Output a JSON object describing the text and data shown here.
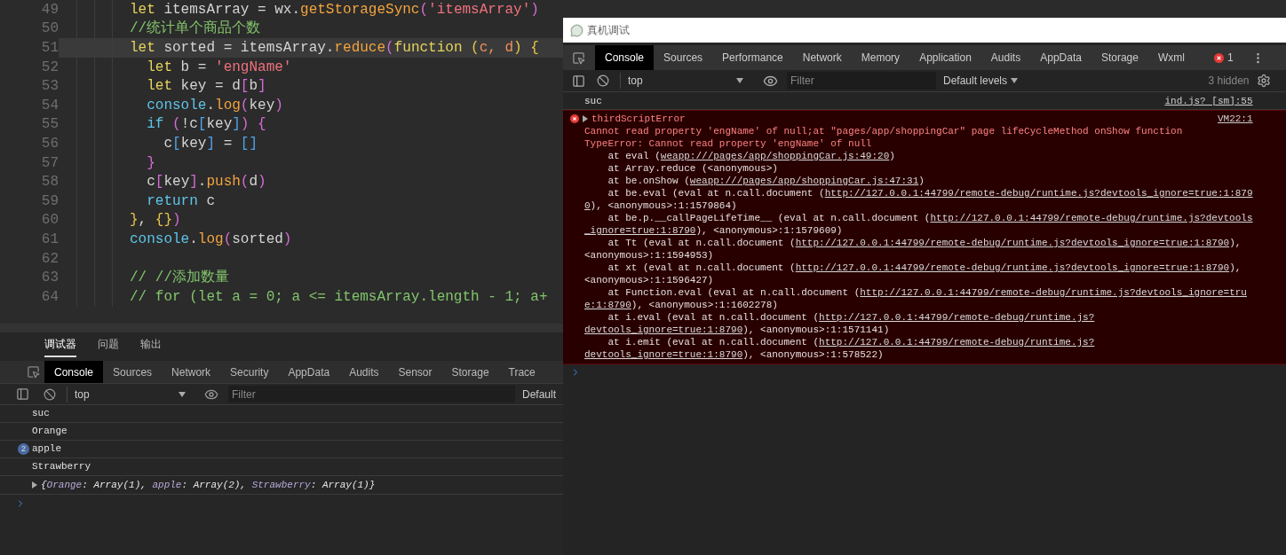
{
  "editor": {
    "lines": [
      {
        "number": "49",
        "current": false,
        "tokens": [
          {
            "kind": "kw",
            "text": "let"
          },
          {
            "kind": "id",
            "text": " itemsArray = wx."
          },
          {
            "kind": "fn",
            "text": "getStorageSync"
          },
          {
            "kind": "b2",
            "text": "("
          },
          {
            "kind": "str",
            "text": "'itemsArray'"
          },
          {
            "kind": "b2",
            "text": ")"
          }
        ]
      },
      {
        "number": "50",
        "current": false,
        "tokens": [
          {
            "kind": "cm",
            "text": "//统计单个商品个数"
          }
        ]
      },
      {
        "number": "51",
        "current": true,
        "tokens": [
          {
            "kind": "kw",
            "text": "let"
          },
          {
            "kind": "id",
            "text": " sorted = itemsArray."
          },
          {
            "kind": "fn",
            "text": "reduce"
          },
          {
            "kind": "b2",
            "text": "("
          },
          {
            "kind": "kw",
            "text": "function "
          },
          {
            "kind": "b1",
            "text": "("
          },
          {
            "kind": "param",
            "text": "c, d"
          },
          {
            "kind": "b1",
            "text": ") {"
          }
        ]
      },
      {
        "number": "52",
        "current": false,
        "tokens": [
          {
            "kind": "kw",
            "text": "  let"
          },
          {
            "kind": "id",
            "text": " b = "
          },
          {
            "kind": "str",
            "text": "'engName'"
          }
        ]
      },
      {
        "number": "53",
        "current": false,
        "tokens": [
          {
            "kind": "kw",
            "text": "  let"
          },
          {
            "kind": "id",
            "text": " key = d"
          },
          {
            "kind": "b2",
            "text": "["
          },
          {
            "kind": "id",
            "text": "b"
          },
          {
            "kind": "b2",
            "text": "]"
          }
        ]
      },
      {
        "number": "54",
        "current": false,
        "tokens": [
          {
            "kind": "obj",
            "text": "  console"
          },
          {
            "kind": "id",
            "text": "."
          },
          {
            "kind": "fn",
            "text": "log"
          },
          {
            "kind": "b2",
            "text": "("
          },
          {
            "kind": "id",
            "text": "key"
          },
          {
            "kind": "b2",
            "text": ")"
          }
        ]
      },
      {
        "number": "55",
        "current": false,
        "tokens": [
          {
            "kind": "obj",
            "text": "  if "
          },
          {
            "kind": "b2",
            "text": "("
          },
          {
            "kind": "id",
            "text": "!c"
          },
          {
            "kind": "b3",
            "text": "["
          },
          {
            "kind": "id",
            "text": "key"
          },
          {
            "kind": "b3",
            "text": "]"
          },
          {
            "kind": "b2",
            "text": ") {"
          }
        ]
      },
      {
        "number": "56",
        "current": false,
        "tokens": [
          {
            "kind": "id",
            "text": "    c"
          },
          {
            "kind": "b3",
            "text": "["
          },
          {
            "kind": "id",
            "text": "key"
          },
          {
            "kind": "b3",
            "text": "]"
          },
          {
            "kind": "id",
            "text": " = "
          },
          {
            "kind": "b3",
            "text": "[]"
          }
        ]
      },
      {
        "number": "57",
        "current": false,
        "tokens": [
          {
            "kind": "b2",
            "text": "  }"
          }
        ]
      },
      {
        "number": "58",
        "current": false,
        "tokens": [
          {
            "kind": "id",
            "text": "  c"
          },
          {
            "kind": "b2",
            "text": "["
          },
          {
            "kind": "id",
            "text": "key"
          },
          {
            "kind": "b2",
            "text": "]"
          },
          {
            "kind": "id",
            "text": "."
          },
          {
            "kind": "fn",
            "text": "push"
          },
          {
            "kind": "b2",
            "text": "("
          },
          {
            "kind": "id",
            "text": "d"
          },
          {
            "kind": "b2",
            "text": ")"
          }
        ]
      },
      {
        "number": "59",
        "current": false,
        "tokens": [
          {
            "kind": "obj",
            "text": "  return"
          },
          {
            "kind": "id",
            "text": " c"
          }
        ]
      },
      {
        "number": "60",
        "current": false,
        "tokens": [
          {
            "kind": "b1",
            "text": "}"
          },
          {
            "kind": "id",
            "text": ", "
          },
          {
            "kind": "b1",
            "text": "{}"
          },
          {
            "kind": "b2",
            "text": ")"
          }
        ]
      },
      {
        "number": "61",
        "current": false,
        "tokens": [
          {
            "kind": "obj",
            "text": "console"
          },
          {
            "kind": "id",
            "text": "."
          },
          {
            "kind": "fn",
            "text": "log"
          },
          {
            "kind": "b2",
            "text": "("
          },
          {
            "kind": "id",
            "text": "sorted"
          },
          {
            "kind": "b2",
            "text": ")"
          }
        ]
      },
      {
        "number": "62",
        "current": false
      },
      {
        "number": "63",
        "current": false,
        "tokens": [
          {
            "kind": "cm",
            "text": "// //添加数量"
          }
        ]
      },
      {
        "number": "64",
        "current": false,
        "tokens": [
          {
            "kind": "cm",
            "text": "// for (let a = 0; a <= itemsArray.length - 1; a+"
          }
        ]
      }
    ]
  },
  "bottom_panel": {
    "tabs": [
      {
        "label": "调试器",
        "selected": true
      },
      {
        "label": "问题",
        "selected": false
      },
      {
        "label": "输出",
        "selected": false
      }
    ],
    "devtools_tabs": [
      {
        "label": "Console",
        "selected": true
      },
      {
        "label": "Sources",
        "selected": false
      },
      {
        "label": "Network",
        "selected": false
      },
      {
        "label": "Security",
        "selected": false
      },
      {
        "label": "AppData",
        "selected": false
      },
      {
        "label": "Audits",
        "selected": false
      },
      {
        "label": "Sensor",
        "selected": false
      },
      {
        "label": "Storage",
        "selected": false
      },
      {
        "label": "Trace",
        "selected": false
      }
    ],
    "toolbar": {
      "context": "top",
      "filter_placeholder": "Filter",
      "levels": "Default"
    },
    "messages": [
      {
        "kind": "log",
        "text": "suc"
      },
      {
        "kind": "log",
        "text": "Orange"
      },
      {
        "kind": "log",
        "text": "apple",
        "count": "2"
      },
      {
        "kind": "log",
        "text": "Strawberry"
      },
      {
        "kind": "object",
        "expanded": false,
        "parts": [
          {
            "kind": "punct",
            "text": "{"
          },
          {
            "kind": "key",
            "text": "Orange"
          },
          {
            "kind": "punct",
            "text": ": Array(1), "
          },
          {
            "kind": "key",
            "text": "apple"
          },
          {
            "kind": "punct",
            "text": ": Array(2), "
          },
          {
            "kind": "key",
            "text": "Strawberry"
          },
          {
            "kind": "punct",
            "text": ": Array(1)}"
          }
        ]
      }
    ]
  },
  "devtools_window": {
    "title": "真机调试",
    "tabs": [
      {
        "label": "Console",
        "selected": true
      },
      {
        "label": "Sources",
        "selected": false
      },
      {
        "label": "Performance",
        "selected": false
      },
      {
        "label": "Network",
        "selected": false
      },
      {
        "label": "Memory",
        "selected": false
      },
      {
        "label": "Application",
        "selected": false
      },
      {
        "label": "Audits",
        "selected": false
      },
      {
        "label": "AppData",
        "selected": false
      },
      {
        "label": "Storage",
        "selected": false
      },
      {
        "label": "Wxml",
        "selected": false
      }
    ],
    "error_count": "1",
    "toolbar": {
      "context": "top",
      "filter_placeholder": "Filter",
      "levels": "Default levels",
      "hidden": "3 hidden"
    },
    "messages": [
      {
        "kind": "log",
        "text": "suc",
        "source": "ind.js? [sm]:55"
      },
      {
        "kind": "error",
        "expanded": false,
        "title": "thirdScriptError",
        "source": "VM22:1",
        "lines": [
          {
            "kind": "message",
            "parts": [
              {
                "kind": "text",
                "text": "Cannot read property 'engName' of null;at \"pages/app/shoppingCar\" page lifeCycleMethod onShow function"
              }
            ]
          },
          {
            "kind": "message",
            "parts": [
              {
                "kind": "text",
                "text": "TypeError: Cannot read property 'engName' of null"
              }
            ]
          },
          {
            "kind": "stack",
            "parts": [
              {
                "kind": "text",
                "text": "    at eval ("
              },
              {
                "kind": "link",
                "text": "weapp:///pages/app/shoppingCar.js:49:20"
              },
              {
                "kind": "text",
                "text": ")"
              }
            ]
          },
          {
            "kind": "stack",
            "parts": [
              {
                "kind": "text",
                "text": "    at Array.reduce (<anonymous>)"
              }
            ]
          },
          {
            "kind": "stack",
            "parts": [
              {
                "kind": "text",
                "text": "    at be.onShow ("
              },
              {
                "kind": "link",
                "text": "weapp:///pages/app/shoppingCar.js:47:31"
              },
              {
                "kind": "text",
                "text": ")"
              }
            ]
          },
          {
            "kind": "stack",
            "parts": [
              {
                "kind": "text",
                "text": "    at be.eval (eval at n.call.document ("
              },
              {
                "kind": "link",
                "text": "http://127.0.0.1:44799/remote-debug/runtime.js?devtools_ignore=true:1:879"
              }
            ]
          },
          {
            "kind": "stack",
            "parts": [
              {
                "kind": "link",
                "text": "0"
              },
              {
                "kind": "text",
                "text": "), <anonymous>:1:1579864)"
              }
            ]
          },
          {
            "kind": "stack",
            "parts": [
              {
                "kind": "text",
                "text": "    at be.p.__callPageLifeTime__ (eval at n.call.document ("
              },
              {
                "kind": "link",
                "text": "http://127.0.0.1:44799/remote-debug/runtime.js?devtools"
              }
            ]
          },
          {
            "kind": "stack",
            "parts": [
              {
                "kind": "link",
                "text": "_ignore=true:1:8790"
              },
              {
                "kind": "text",
                "text": "), <anonymous>:1:1579609)"
              }
            ]
          },
          {
            "kind": "stack",
            "parts": [
              {
                "kind": "text",
                "text": "    at Tt (eval at n.call.document ("
              },
              {
                "kind": "link",
                "text": "http://127.0.0.1:44799/remote-debug/runtime.js?devtools_ignore=true:1:8790"
              },
              {
                "kind": "text",
                "text": "),"
              }
            ]
          },
          {
            "kind": "stack",
            "parts": [
              {
                "kind": "text",
                "text": "<anonymous>:1:1594953)"
              }
            ]
          },
          {
            "kind": "stack",
            "parts": [
              {
                "kind": "text",
                "text": "    at xt (eval at n.call.document ("
              },
              {
                "kind": "link",
                "text": "http://127.0.0.1:44799/remote-debug/runtime.js?devtools_ignore=true:1:8790"
              },
              {
                "kind": "text",
                "text": "),"
              }
            ]
          },
          {
            "kind": "stack",
            "parts": [
              {
                "kind": "text",
                "text": "<anonymous>:1:1596427)"
              }
            ]
          },
          {
            "kind": "stack",
            "parts": [
              {
                "kind": "text",
                "text": "    at Function.eval (eval at n.call.document ("
              },
              {
                "kind": "link",
                "text": "http://127.0.0.1:44799/remote-debug/runtime.js?devtools_ignore=tru"
              }
            ]
          },
          {
            "kind": "stack",
            "parts": [
              {
                "kind": "link",
                "text": "e:1:8790"
              },
              {
                "kind": "text",
                "text": "), <anonymous>:1:1602278)"
              }
            ]
          },
          {
            "kind": "stack",
            "parts": [
              {
                "kind": "text",
                "text": "    at i.eval (eval at n.call.document ("
              },
              {
                "kind": "link",
                "text": "http://127.0.0.1:44799/remote-debug/runtime.js?"
              }
            ]
          },
          {
            "kind": "stack",
            "parts": [
              {
                "kind": "link",
                "text": "devtools_ignore=true:1:8790"
              },
              {
                "kind": "text",
                "text": "), <anonymous>:1:1571141)"
              }
            ]
          },
          {
            "kind": "stack",
            "parts": [
              {
                "kind": "text",
                "text": "    at i.emit (eval at n.call.document ("
              },
              {
                "kind": "link",
                "text": "http://127.0.0.1:44799/remote-debug/runtime.js?"
              }
            ]
          },
          {
            "kind": "stack",
            "parts": [
              {
                "kind": "link",
                "text": "devtools_ignore=true:1:8790"
              },
              {
                "kind": "text",
                "text": "), <anonymous>:1:578522)"
              }
            ]
          }
        ]
      }
    ]
  }
}
